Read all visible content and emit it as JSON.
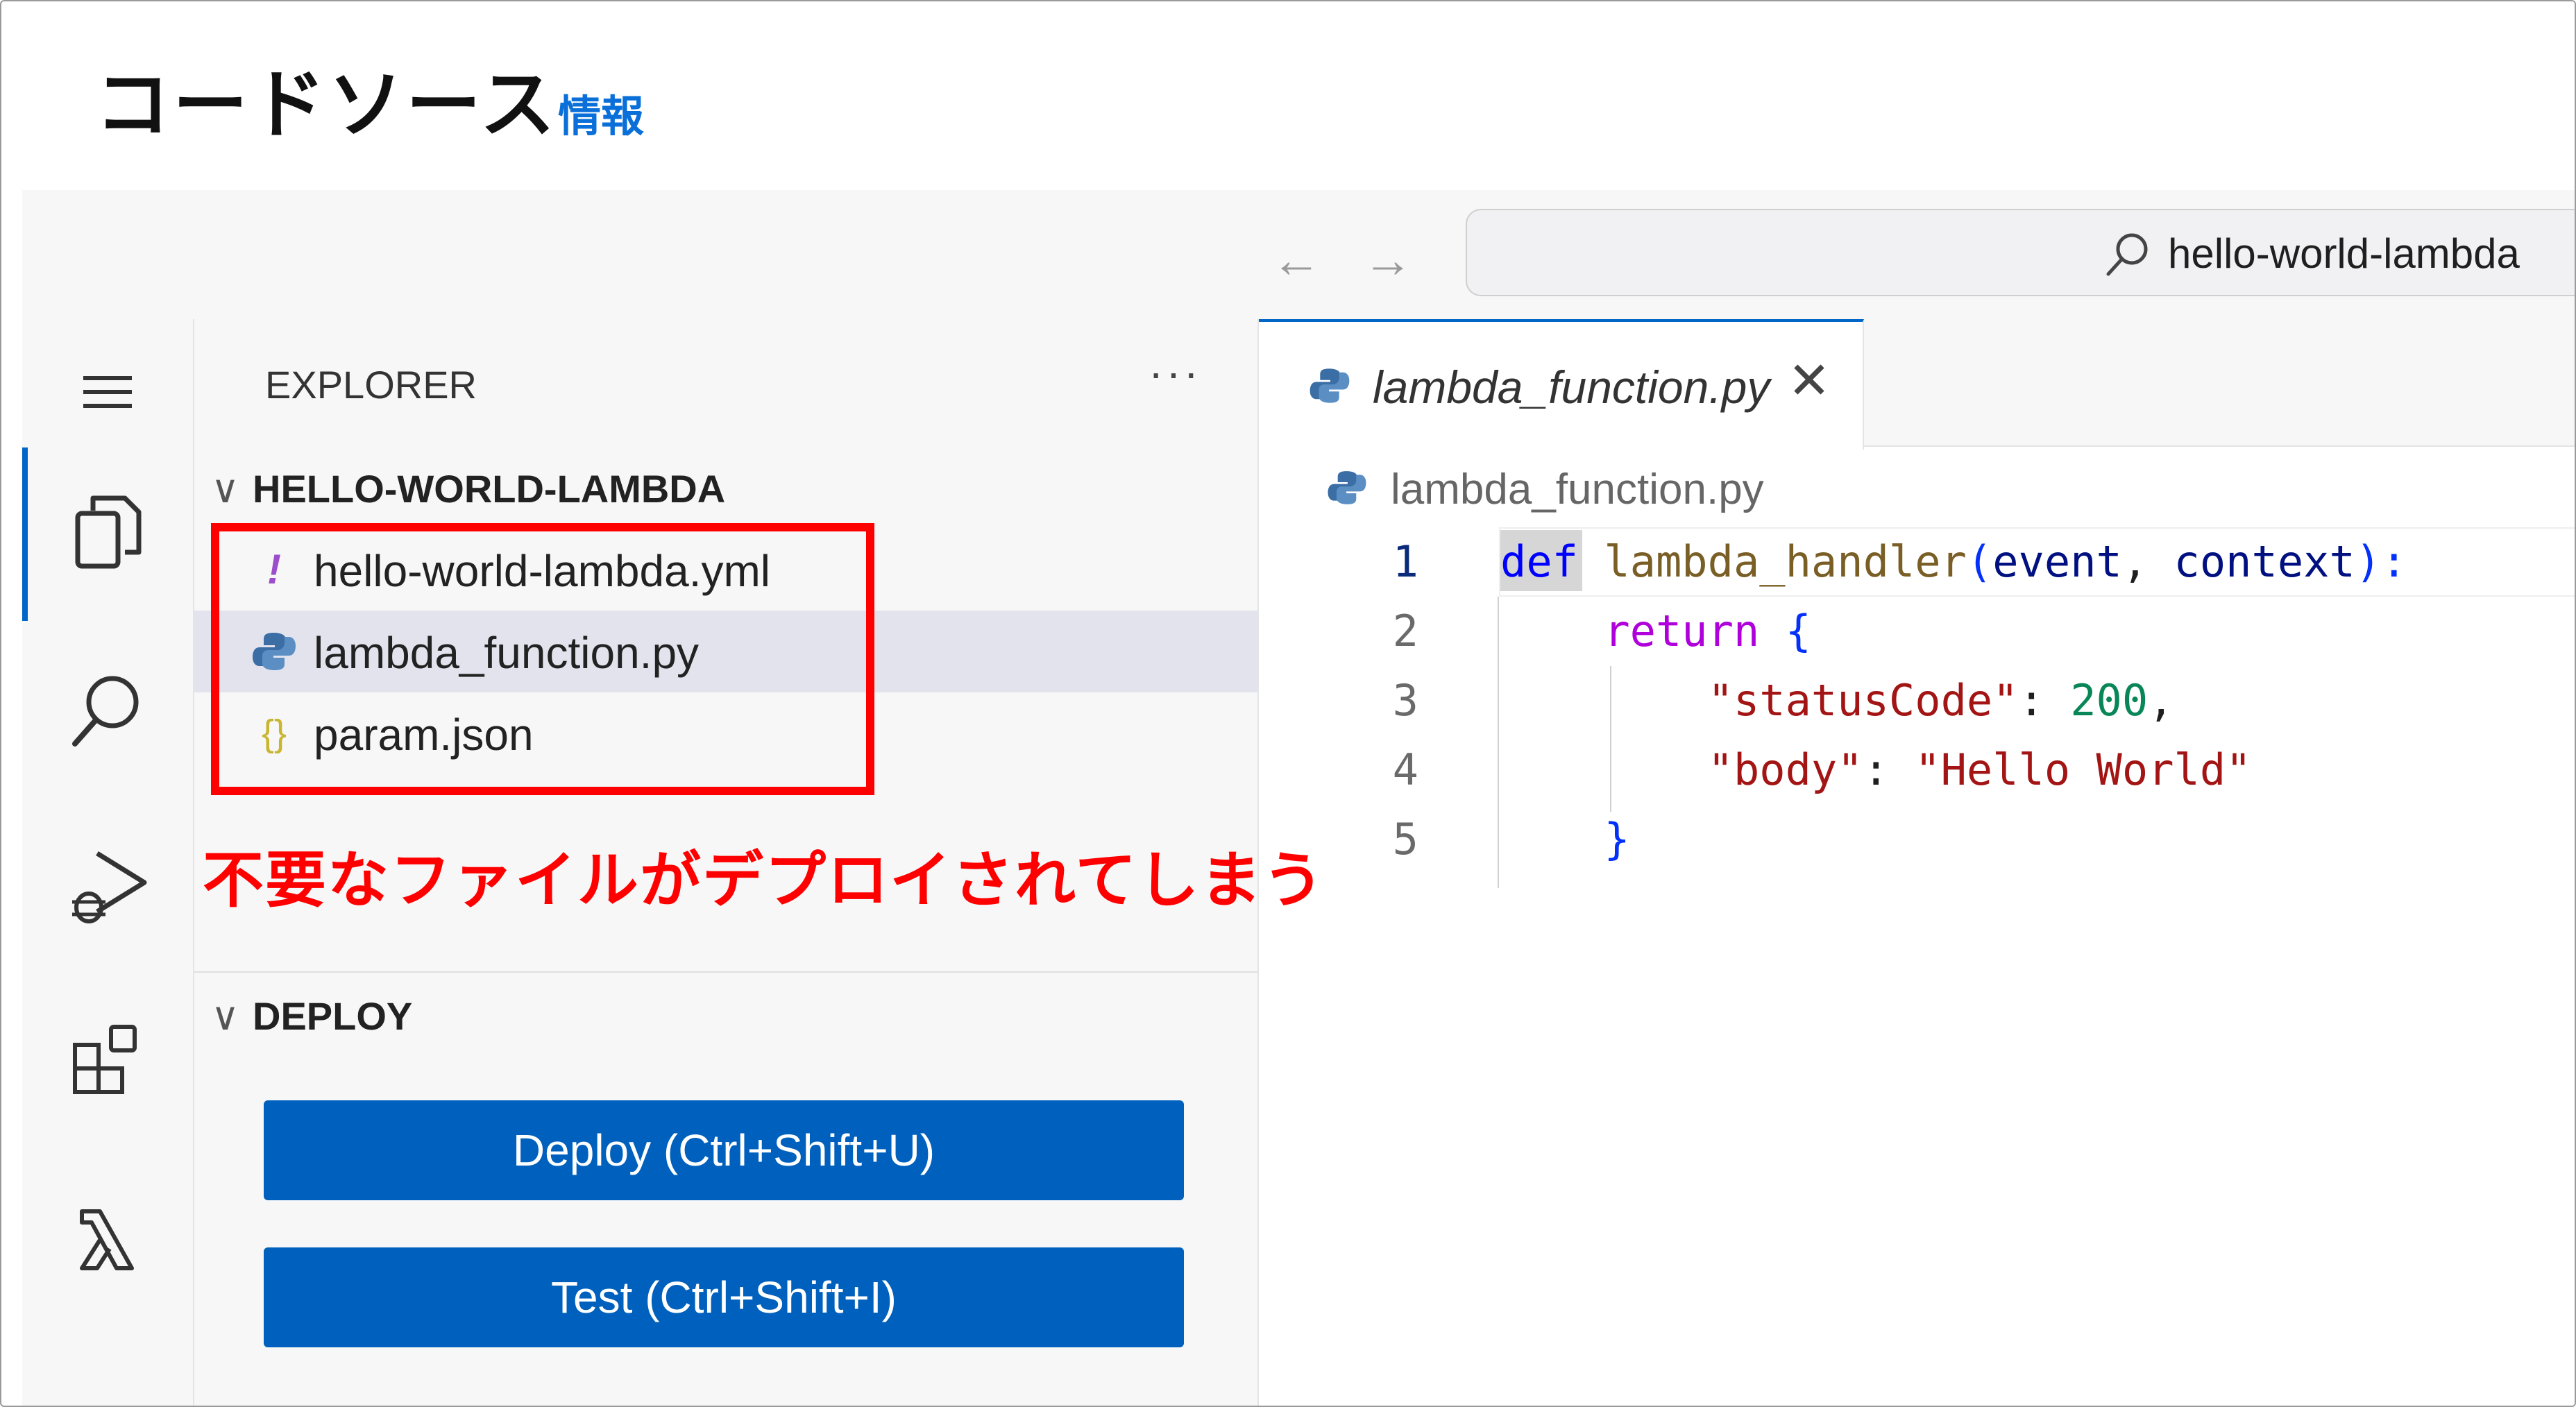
{
  "header": {
    "title": "コードソース",
    "info_link": "情報"
  },
  "toolbar": {
    "back_glyph": "←",
    "forward_glyph": "→",
    "search_value": "hello-world-lambda"
  },
  "activity_bar": {
    "icons": [
      "menu-icon",
      "files-icon",
      "search-icon",
      "run-debug-icon",
      "extensions-icon",
      "lambda-icon"
    ]
  },
  "explorer": {
    "title": "EXPLORER",
    "more": "···",
    "folder": "HELLO-WORLD-LAMBDA",
    "files": [
      {
        "name": "hello-world-lambda.yml",
        "icon": "yaml-icon",
        "icon_glyph": "!"
      },
      {
        "name": "lambda_function.py",
        "icon": "python-icon"
      },
      {
        "name": "param.json",
        "icon": "json-icon",
        "icon_glyph": "{}"
      }
    ],
    "deploy_section": "DEPLOY",
    "deploy_button": "Deploy (Ctrl+Shift+U)",
    "test_button": "Test (Ctrl+Shift+I)"
  },
  "editor": {
    "tab_label": "lambda_function.py",
    "tab_close": "✕",
    "breadcrumb": "lambda_function.py",
    "line_numbers": [
      "1",
      "2",
      "3",
      "4",
      "5"
    ],
    "code": {
      "l1_def": "def",
      "l1_fn": "lambda_handler",
      "l1_open": "(",
      "l1_p1": "event",
      "l1_comma": ", ",
      "l1_p2": "context",
      "l1_close": "):",
      "l2_ret": "return",
      "l2_brace": "{",
      "l3_key": "\"statusCode\"",
      "l3_colon": ": ",
      "l3_val": "200",
      "l3_comma": ",",
      "l4_key": "\"body\"",
      "l4_colon": ": ",
      "l4_val": "\"Hello World\"",
      "l5_brace": "}"
    }
  },
  "annotation": {
    "text": "不要なファイルがデプロイされてしまう",
    "color": "#ff0000"
  }
}
